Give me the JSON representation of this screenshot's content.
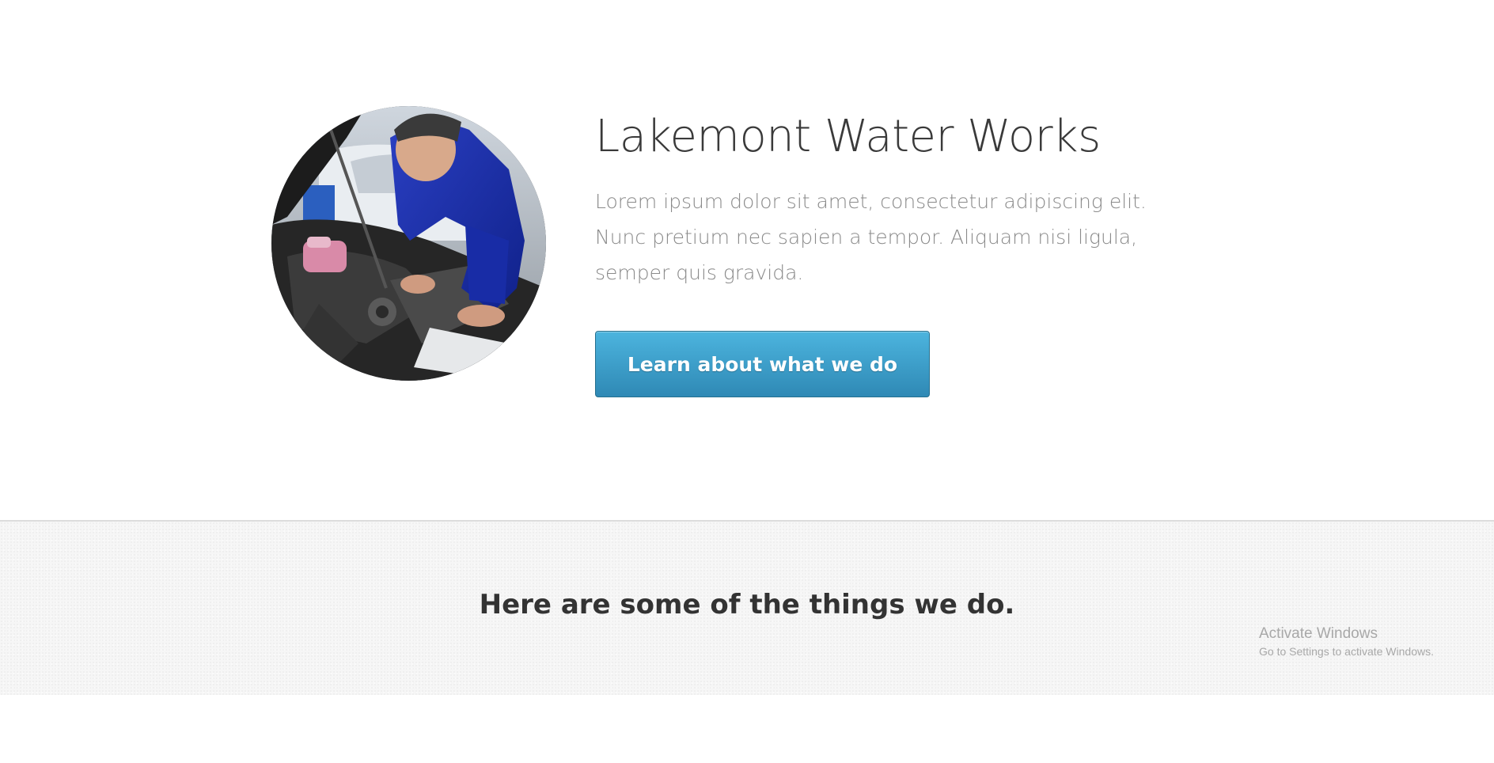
{
  "hero": {
    "title": "Lakemont Water Works",
    "description": "Lorem ipsum dolor sit amet, consectetur adipiscing elit. Nunc pretium nec sapien a tempor. Aliquam nisi ligula, semper quis gravida.",
    "cta_label": "Learn about what we do",
    "image_subject": "mechanic working on car engine",
    "cta_color": "#3a9fcd"
  },
  "features": {
    "heading": "Here are some of the things we do."
  },
  "watermark": {
    "title": "Activate Windows",
    "subtitle": "Go to Settings to activate Windows."
  }
}
